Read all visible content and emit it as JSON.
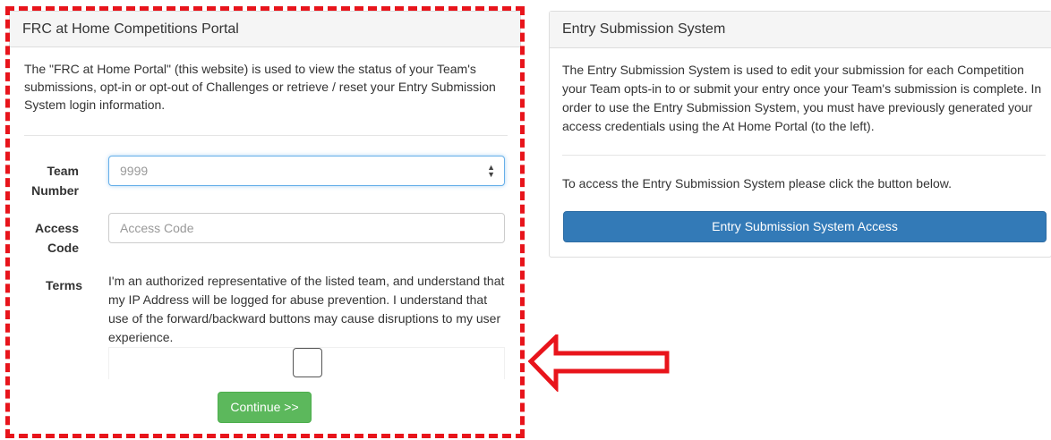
{
  "left_panel": {
    "heading": "FRC at Home Competitions Portal",
    "intro": "The \"FRC at Home Portal\" (this website) is used to view the status of your Team's submissions, opt-in or opt-out of Challenges or retrieve / reset your Entry Submission System login information.",
    "form": {
      "team_label_1": "Team",
      "team_label_2": "Number",
      "team_placeholder": "9999",
      "access_label_1": "Access",
      "access_label_2": "Code",
      "access_placeholder": "Access Code",
      "terms_label": "Terms",
      "terms_text": "I'm an authorized representative of the listed team, and understand that my IP Address will be logged for abuse prevention. I understand that use of the forward/backward buttons may cause disruptions to my user experience.",
      "continue_label": "Continue >>"
    }
  },
  "right_panel": {
    "heading": "Entry Submission System",
    "description": "The Entry Submission System is used to edit your submission for each Competition your Team opts-in to or submit your entry once your Team's submission is complete. In order to use the Entry Submission System, you must have previously generated your access credentials using the At Home Portal (to the left).",
    "prompt": "To access the Entry Submission System please click the button below.",
    "button_label": "Entry Submission System Access"
  },
  "annotation": {
    "highlight_color": "#e8141b",
    "arrow_icon": "left-arrow-icon"
  },
  "colors": {
    "success": "#5cb85c",
    "primary": "#337ab7",
    "focus": "#66afe9"
  }
}
